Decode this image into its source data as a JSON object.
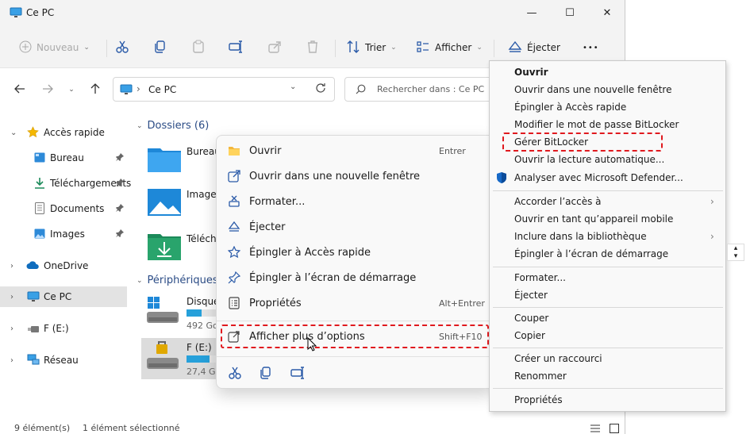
{
  "window": {
    "title": "Ce PC",
    "controls": {
      "minimize": "—",
      "maximize": "☐",
      "close": "✕"
    }
  },
  "commandbar": {
    "new_label": "Nouveau",
    "sort_label": "Trier",
    "view_label": "Afficher",
    "eject_label": "Éjecter",
    "more_label": "•••"
  },
  "address": {
    "path_separator": "›",
    "path": "Ce PC",
    "search_placeholder": "Rechercher dans : Ce PC"
  },
  "sidebar": {
    "items": [
      {
        "label": "Accès rapide",
        "icon": "star-icon",
        "expander": "⌄"
      },
      {
        "label": "Bureau",
        "icon": "desktop-icon",
        "pin": "📌"
      },
      {
        "label": "Téléchargements",
        "icon": "download-icon",
        "pin": "📌"
      },
      {
        "label": "Documents",
        "icon": "documents-icon",
        "pin": "📌"
      },
      {
        "label": "Images",
        "icon": "images-icon",
        "pin": "📌"
      },
      {
        "label": "OneDrive",
        "icon": "cloud-icon",
        "expander": "›"
      },
      {
        "label": "Ce PC",
        "icon": "monitor-icon",
        "expander": "›"
      },
      {
        "label": "F (E:)",
        "icon": "usb-drive-icon",
        "expander": "›"
      },
      {
        "label": "Réseau",
        "icon": "network-icon",
        "expander": "›"
      }
    ]
  },
  "content": {
    "folders_title": "Dossiers (6)",
    "folders": [
      {
        "name": "Bureau",
        "icon": "desktop-folder-icon"
      },
      {
        "name": "Images",
        "icon": "images-folder-icon"
      },
      {
        "name": "Téléch",
        "icon": "downloads-folder-icon"
      }
    ],
    "devices_title": "Périphériques",
    "drives": [
      {
        "name": "Disque",
        "size": "492 Go",
        "fill": 0.35,
        "icon": "windows-drive-icon"
      },
      {
        "name": "F (E:)",
        "size": "27,4 Go",
        "fill": 0.55,
        "icon": "locked-drive-icon"
      }
    ]
  },
  "status": {
    "count": "9 élément(s)",
    "selected": "1 élément sélectionné"
  },
  "context_menu": {
    "items": [
      {
        "label": "Ouvrir",
        "key": "Entrer",
        "icon": "folder-icon"
      },
      {
        "label": "Ouvrir dans une nouvelle fenêtre",
        "key": "",
        "icon": "new-window-icon"
      },
      {
        "label": "Formater...",
        "key": "",
        "icon": "format-icon"
      },
      {
        "label": "Éjecter",
        "key": "",
        "icon": "eject-icon"
      },
      {
        "label": "Épingler à Accès rapide",
        "key": "",
        "icon": "star-outline-icon"
      },
      {
        "label": "Épingler à l’écran de démarrage",
        "key": "",
        "icon": "pin-icon"
      },
      {
        "label": "Propriétés",
        "key": "Alt+Entrer",
        "icon": "properties-icon"
      },
      {
        "label": "Afficher plus d’options",
        "key": "Shift+F10",
        "icon": "more-options-icon"
      }
    ]
  },
  "classic_menu": {
    "items": [
      {
        "label": "Ouvrir",
        "bold": true
      },
      {
        "label": "Ouvrir dans une nouvelle fenêtre"
      },
      {
        "label": "Épingler à Accès rapide"
      },
      {
        "label": "Modifier le mot de passe BitLocker"
      },
      {
        "label": "Gérer BitLocker"
      },
      {
        "label": "Ouvrir la lecture automatique..."
      },
      {
        "label": "Analyser avec Microsoft Defender..."
      },
      {
        "label": "Accorder l’accès à",
        "submenu": "›"
      },
      {
        "label": "Ouvrir en tant qu’appareil mobile"
      },
      {
        "label": "Inclure dans la bibliothèque",
        "submenu": "›"
      },
      {
        "label": "Épingler à l’écran de démarrage"
      },
      {
        "label": "Formater..."
      },
      {
        "label": "Éjecter"
      },
      {
        "label": "Couper"
      },
      {
        "label": "Copier"
      },
      {
        "label": "Créer un raccourci"
      },
      {
        "label": "Renommer"
      },
      {
        "label": "Propriétés"
      }
    ]
  },
  "colors": {
    "accent": "#0067c0",
    "highlight": "#e0191e",
    "folder_blue": "#1e88d8"
  }
}
